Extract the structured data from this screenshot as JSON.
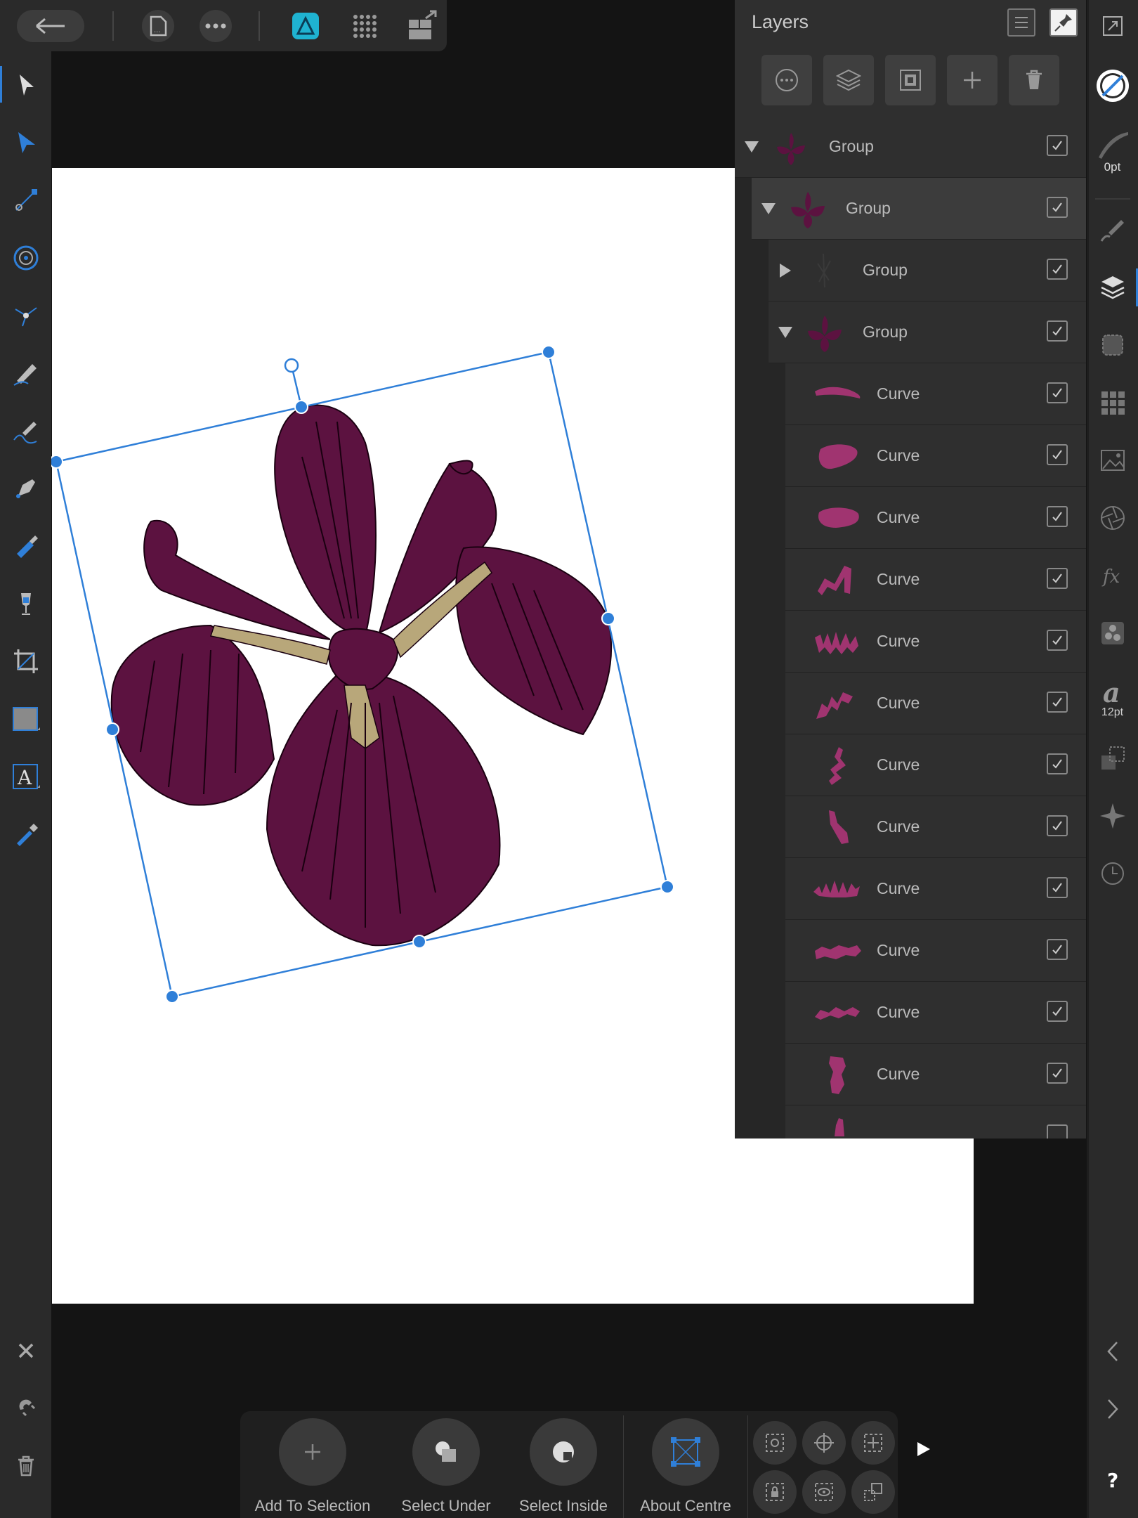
{
  "layers_panel": {
    "title": "Layers",
    "rows": [
      {
        "label": "Group",
        "expanded": true,
        "checked": true
      },
      {
        "label": "Group",
        "expanded": true,
        "checked": true,
        "selected": true
      },
      {
        "label": "Group",
        "expanded": false,
        "checked": true
      },
      {
        "label": "Group",
        "expanded": true,
        "checked": true
      },
      {
        "label": "Curve",
        "checked": true
      },
      {
        "label": "Curve",
        "checked": true
      },
      {
        "label": "Curve",
        "checked": true
      },
      {
        "label": "Curve",
        "checked": true
      },
      {
        "label": "Curve",
        "checked": true
      },
      {
        "label": "Curve",
        "checked": true
      },
      {
        "label": "Curve",
        "checked": true
      },
      {
        "label": "Curve",
        "checked": true
      },
      {
        "label": "Curve",
        "checked": true
      },
      {
        "label": "Curve",
        "checked": true
      },
      {
        "label": "Curve",
        "checked": true
      },
      {
        "label": "Curve",
        "checked": true
      }
    ]
  },
  "right_strip": {
    "stroke_width": "0pt",
    "font_size": "12pt"
  },
  "context_bar": {
    "add_to_selection": "Add To Selection",
    "select_under": "Select Under",
    "select_inside": "Select Inside",
    "about_centre": "About Centre"
  },
  "colors": {
    "accent": "#2f7fd8",
    "app_icon": "#1fb3d1",
    "petal": "#5c1240",
    "curve_thumb": "#a03470"
  }
}
